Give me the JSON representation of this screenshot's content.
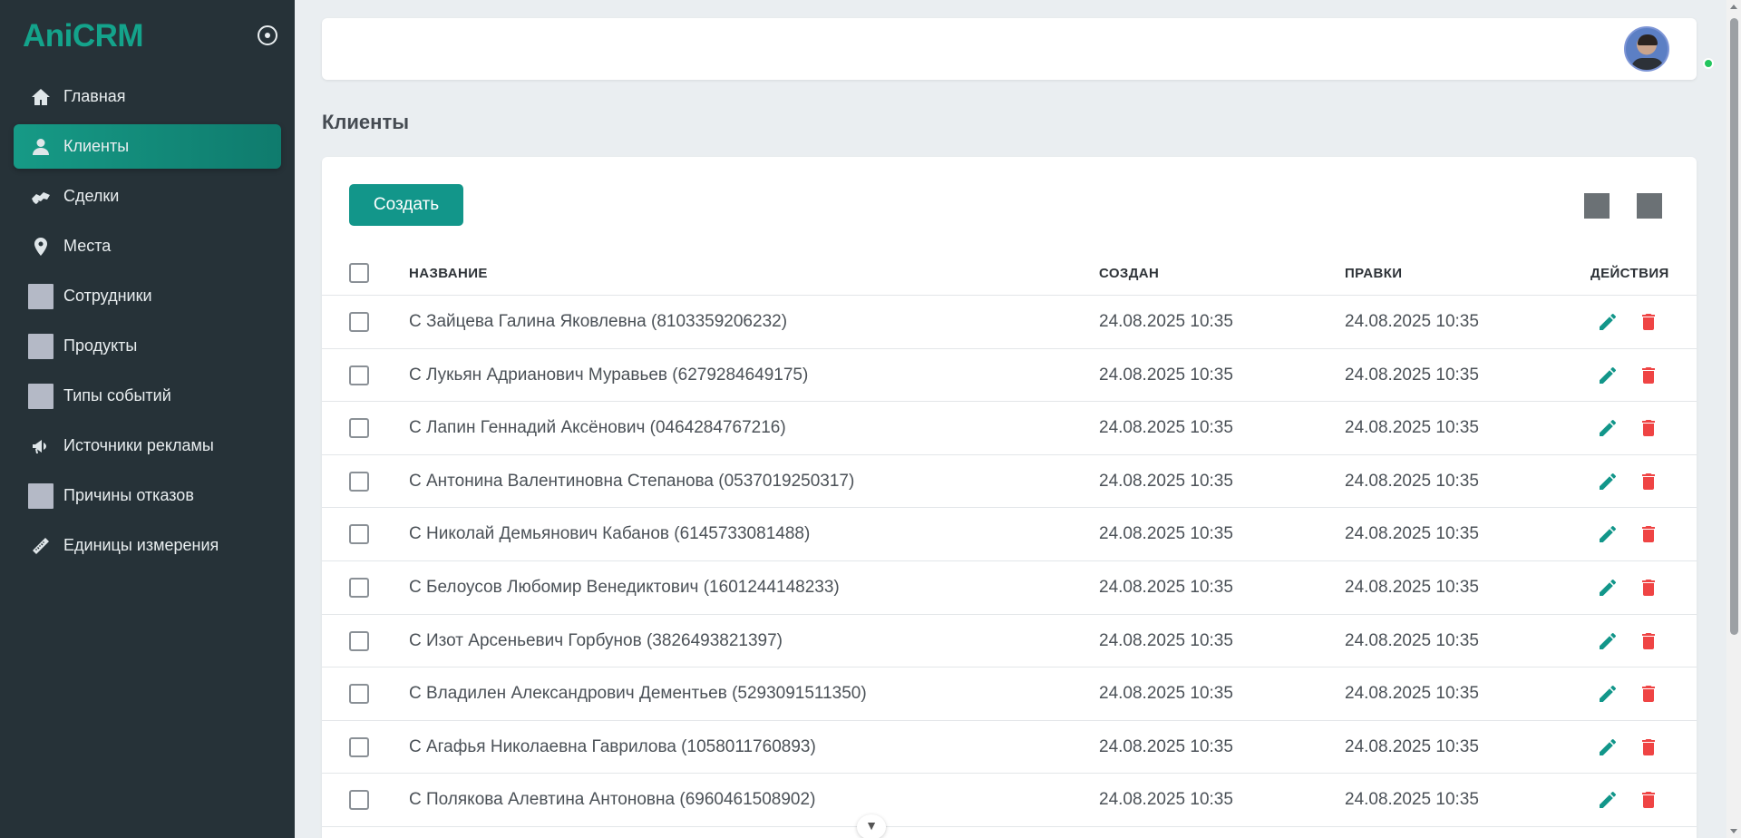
{
  "app": {
    "brand": "AniCRM"
  },
  "sidebar": {
    "items": [
      {
        "label": "Главная",
        "icon": "home-icon",
        "active": false
      },
      {
        "label": "Клиенты",
        "icon": "user-icon",
        "active": true
      },
      {
        "label": "Сделки",
        "icon": "handshake-icon",
        "active": false
      },
      {
        "label": "Места",
        "icon": "location-pin-icon",
        "active": false
      },
      {
        "label": "Сотрудники",
        "icon": "placeholder-icon",
        "active": false
      },
      {
        "label": "Продукты",
        "icon": "placeholder-icon",
        "active": false
      },
      {
        "label": "Типы событий",
        "icon": "placeholder-icon",
        "active": false
      },
      {
        "label": "Источники рекламы",
        "icon": "megaphone-icon",
        "active": false
      },
      {
        "label": "Причины отказов",
        "icon": "placeholder-icon",
        "active": false
      },
      {
        "label": "Единицы измерения",
        "icon": "ruler-icon",
        "active": false
      }
    ]
  },
  "page": {
    "title": "Клиенты"
  },
  "toolbar": {
    "create_label": "Создать"
  },
  "table": {
    "headers": {
      "name": "НАЗВАНИЕ",
      "created": "СОЗДАН",
      "edited": "ПРАВКИ",
      "actions": "ДЕЙСТВИЯ"
    },
    "rows": [
      {
        "name": "С Зайцева Галина Яковлевна (8103359206232)",
        "created": "24.08.2025 10:35",
        "edited": "24.08.2025 10:35"
      },
      {
        "name": "С Лукьян Адрианович Муравьев (6279284649175)",
        "created": "24.08.2025 10:35",
        "edited": "24.08.2025 10:35"
      },
      {
        "name": "С Лапин Геннадий Аксёнович (0464284767216)",
        "created": "24.08.2025 10:35",
        "edited": "24.08.2025 10:35"
      },
      {
        "name": "С Антонина Валентиновна Степанова (0537019250317)",
        "created": "24.08.2025 10:35",
        "edited": "24.08.2025 10:35"
      },
      {
        "name": "С Николай Демьянович Кабанов (6145733081488)",
        "created": "24.08.2025 10:35",
        "edited": "24.08.2025 10:35"
      },
      {
        "name": "С Белоусов Любомир Венедиктович (1601244148233)",
        "created": "24.08.2025 10:35",
        "edited": "24.08.2025 10:35"
      },
      {
        "name": "С Изот Арсеньевич Горбунов (3826493821397)",
        "created": "24.08.2025 10:35",
        "edited": "24.08.2025 10:35"
      },
      {
        "name": "С Владилен Александрович Дементьев (5293091511350)",
        "created": "24.08.2025 10:35",
        "edited": "24.08.2025 10:35"
      },
      {
        "name": "С Агафья Николаевна Гаврилова (1058011760893)",
        "created": "24.08.2025 10:35",
        "edited": "24.08.2025 10:35"
      },
      {
        "name": "С Полякова Алевтина Антоновна (6960461508902)",
        "created": "24.08.2025 10:35",
        "edited": "24.08.2025 10:35"
      }
    ]
  },
  "colors": {
    "accent": "#12968a",
    "sidebar_bg": "#263238",
    "delete": "#ef4444",
    "online": "#22c55e"
  }
}
